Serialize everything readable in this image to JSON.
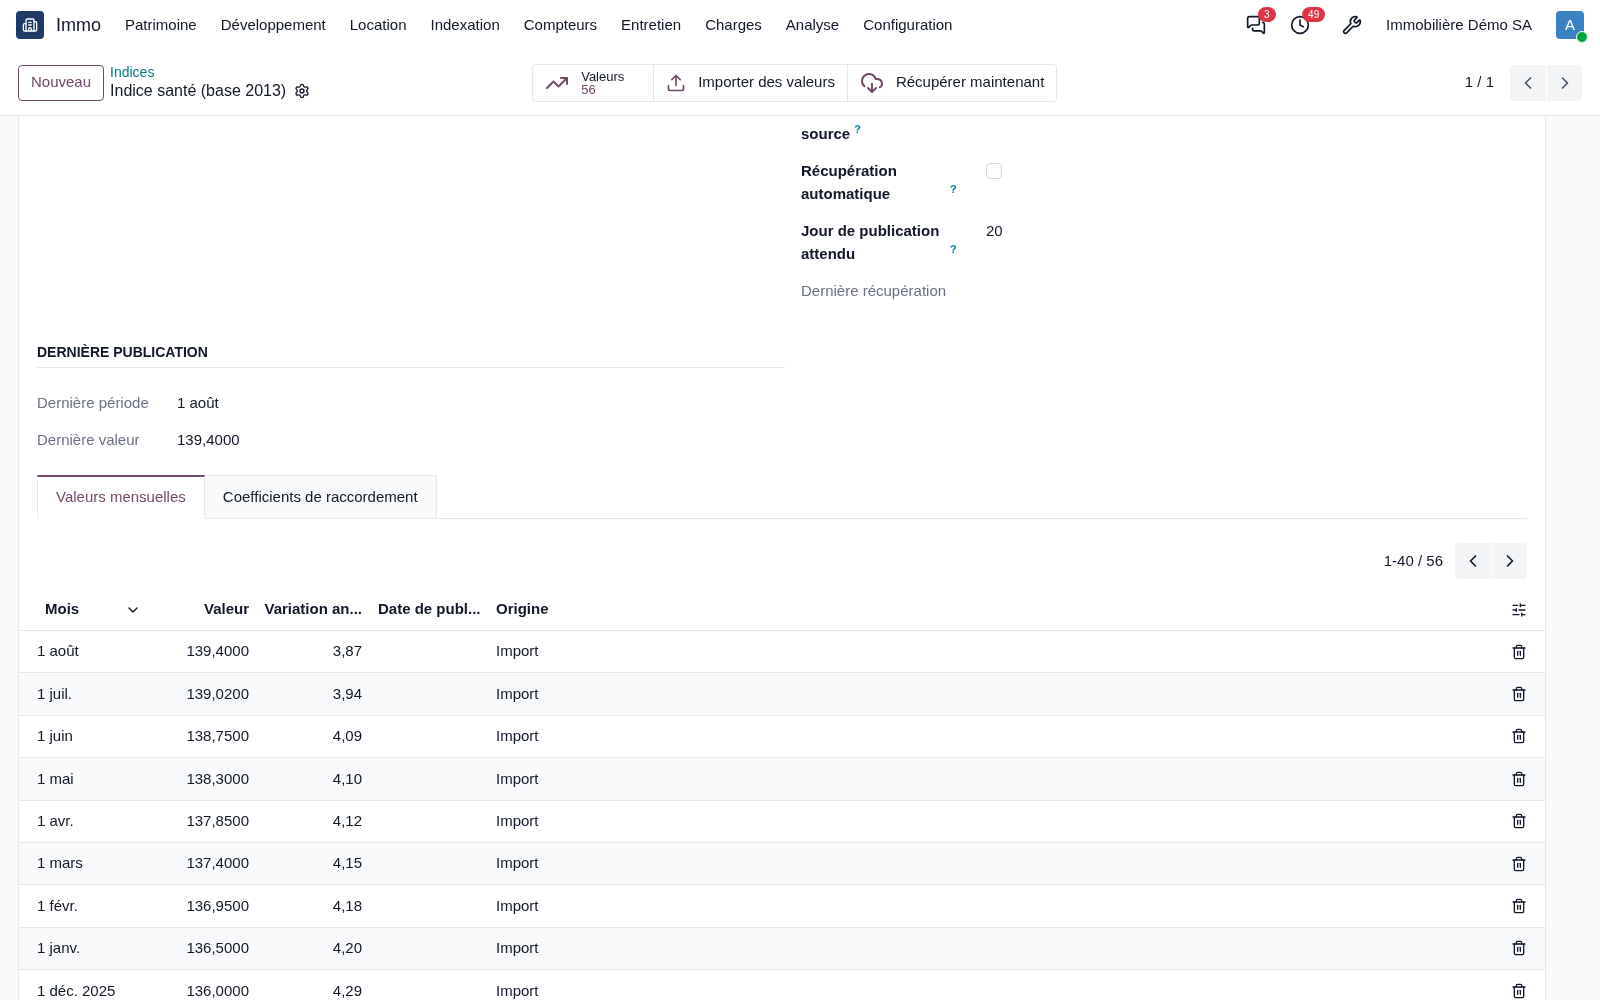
{
  "navbar": {
    "app_name": "Immo",
    "menu": [
      "Patrimoine",
      "Développement",
      "Location",
      "Indexation",
      "Compteurs",
      "Entretien",
      "Charges",
      "Analyse",
      "Configuration"
    ],
    "messages_count": "3",
    "activities_count": "49",
    "company": "Immobilière Démo SA",
    "avatar_letter": "A"
  },
  "control_panel": {
    "new_button": "Nouveau",
    "breadcrumb": "Indices",
    "record_title": "Indice santé (base 2013)",
    "smart_buttons": [
      {
        "kind": "stat",
        "label": "Valeurs",
        "value": "56"
      },
      {
        "kind": "upload",
        "label": "Importer des valeurs"
      },
      {
        "kind": "cloud",
        "label": "Récupérer maintenant"
      }
    ],
    "pager": "1 / 1"
  },
  "right_fields": [
    {
      "kind": "text",
      "label": "source",
      "help": "?"
    },
    {
      "kind": "checkbox",
      "label": "Récupération automatique",
      "help": "?",
      "checked": false
    },
    {
      "kind": "text",
      "label": "Jour de publication attendu",
      "help": "?",
      "value": "20"
    },
    {
      "kind": "empty",
      "label": "Dernière récupération"
    }
  ],
  "last_publication": {
    "title": "DERNIÈRE PUBLICATION",
    "fields": [
      {
        "label": "Dernière période",
        "value": "1 août"
      },
      {
        "label": "Dernière valeur",
        "value": "139,4000"
      }
    ]
  },
  "tabs": [
    {
      "label": "Valeurs mensuelles",
      "selected": true
    },
    {
      "label": "Coefficients de raccordement",
      "selected": false
    }
  ],
  "list": {
    "pager": "1-40 / 56",
    "columns": [
      {
        "label": "Mois",
        "sorted": true
      },
      {
        "label": "Valeur",
        "sorted": false
      },
      {
        "label": "Variation an...",
        "sorted": false
      },
      {
        "label": "Date de publ...",
        "sorted": false
      },
      {
        "label": "Origine",
        "sorted": false
      }
    ],
    "rows": [
      {
        "month": "1 août",
        "value": "139,4000",
        "variation": "3,87",
        "origin": "Import"
      },
      {
        "month": "1 juil.",
        "value": "139,0200",
        "variation": "3,94",
        "origin": "Import"
      },
      {
        "month": "1 juin",
        "value": "138,7500",
        "variation": "4,09",
        "origin": "Import"
      },
      {
        "month": "1 mai",
        "value": "138,3000",
        "variation": "4,10",
        "origin": "Import"
      },
      {
        "month": "1 avr.",
        "value": "137,8500",
        "variation": "4,12",
        "origin": "Import"
      },
      {
        "month": "1 mars",
        "value": "137,4000",
        "variation": "4,15",
        "origin": "Import"
      },
      {
        "month": "1 févr.",
        "value": "136,9500",
        "variation": "4,18",
        "origin": "Import"
      },
      {
        "month": "1 janv.",
        "value": "136,5000",
        "variation": "4,20",
        "origin": "Import"
      },
      {
        "month": "1 déc. 2025",
        "value": "136,0000",
        "variation": "4,29",
        "origin": "Import"
      }
    ]
  }
}
